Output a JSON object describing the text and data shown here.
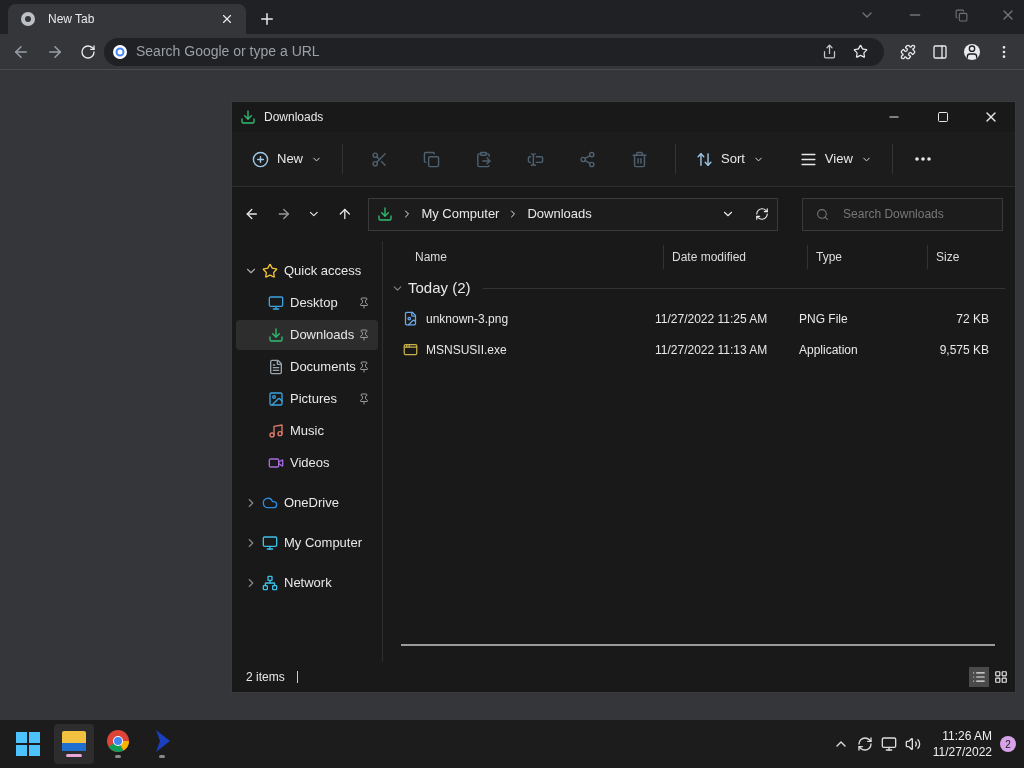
{
  "browser": {
    "tab": {
      "title": "New Tab"
    },
    "omnibox": {
      "placeholder": "Search Google or type a URL"
    }
  },
  "explorer": {
    "title": "Downloads",
    "toolbar": [
      {
        "kind": "menu",
        "label": "New",
        "disabled": false
      },
      {
        "kind": "icon",
        "disabled": true
      },
      {
        "kind": "icon",
        "disabled": true
      },
      {
        "kind": "icon",
        "disabled": true
      },
      {
        "kind": "icon",
        "disabled": true
      },
      {
        "kind": "icon",
        "disabled": true
      },
      {
        "kind": "icon",
        "disabled": true
      },
      {
        "kind": "menu",
        "label": "Sort",
        "disabled": false
      },
      {
        "kind": "menu",
        "label": "View",
        "disabled": false
      },
      {
        "kind": "more"
      }
    ],
    "breadcrumb": [
      "My Computer",
      "Downloads"
    ],
    "search": {
      "placeholder": "Search Downloads"
    },
    "sidebar": [
      {
        "label": "Quick access",
        "expanded": true,
        "selected": false,
        "children": [
          {
            "label": "Desktop",
            "pinned": true,
            "selected": false
          },
          {
            "label": "Downloads",
            "pinned": true,
            "selected": true
          },
          {
            "label": "Documents",
            "pinned": true,
            "selected": false
          },
          {
            "label": "Pictures",
            "pinned": true,
            "selected": false
          },
          {
            "label": "Music",
            "pinned": false,
            "selected": false
          },
          {
            "label": "Videos",
            "pinned": false,
            "selected": false
          }
        ]
      },
      {
        "label": "OneDrive",
        "expanded": false,
        "selected": false
      },
      {
        "label": "My Computer",
        "expanded": false,
        "selected": false
      },
      {
        "label": "Network",
        "expanded": false,
        "selected": false
      }
    ],
    "columns": [
      "Name",
      "Date modified",
      "Type",
      "Size"
    ],
    "group": {
      "label": "Today (2)",
      "expanded": true
    },
    "files": [
      {
        "name": "unknown-3.png",
        "date": "11/27/2022 11:25 AM",
        "type": "PNG File",
        "size": "72 KB"
      },
      {
        "name": "MSNSUSII.exe",
        "date": "11/27/2022 11:13 AM",
        "type": "Application",
        "size": "9,575 KB"
      }
    ],
    "status": "2 items",
    "view_buttons": [
      {
        "selected": true
      },
      {
        "selected": false
      }
    ]
  },
  "taskbar": {
    "apps": [
      {
        "active": true
      },
      {
        "active": false
      },
      {
        "active": false
      }
    ],
    "time": "11:26 AM",
    "date": "11/27/2022",
    "notifications": "2"
  }
}
